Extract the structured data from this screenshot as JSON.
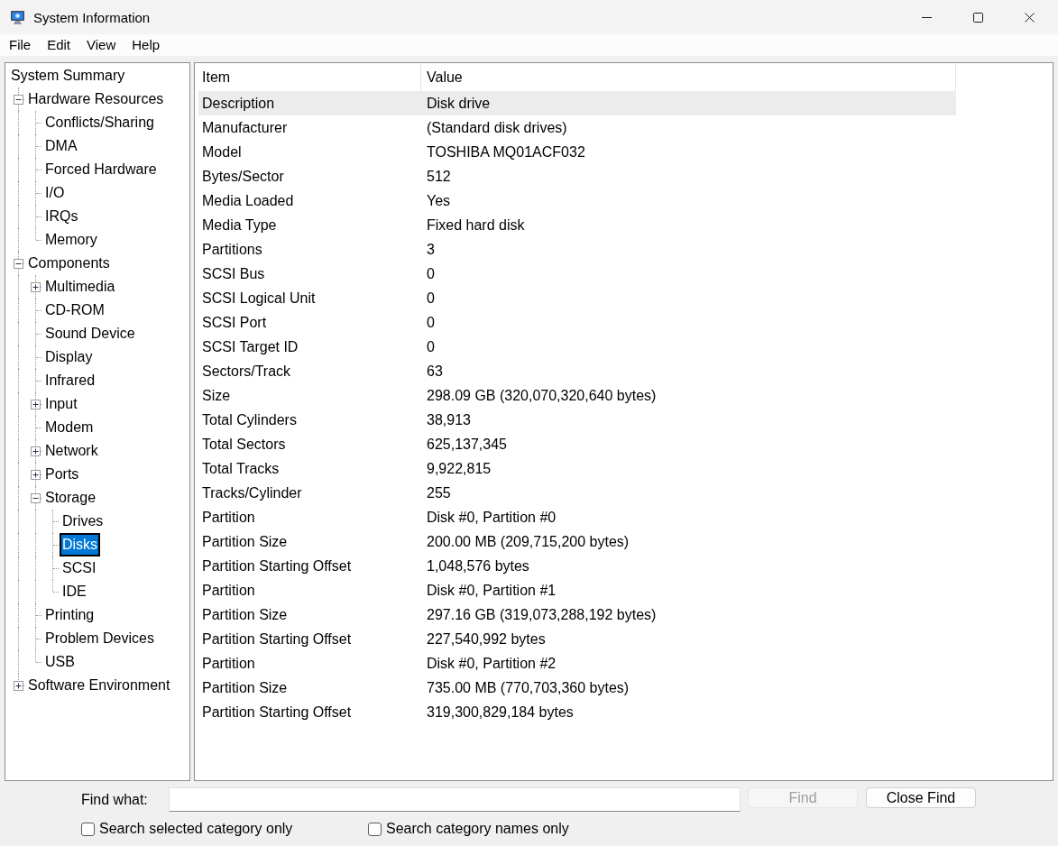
{
  "window": {
    "title": "System Information"
  },
  "menu": [
    "File",
    "Edit",
    "View",
    "Help"
  ],
  "tree": [
    {
      "label": "System Summary",
      "selected": false,
      "children": [
        {
          "label": "Hardware Resources",
          "expanded": true,
          "selected": false,
          "children": [
            {
              "label": "Conflicts/Sharing",
              "selected": false
            },
            {
              "label": "DMA",
              "selected": false
            },
            {
              "label": "Forced Hardware",
              "selected": false
            },
            {
              "label": "I/O",
              "selected": false
            },
            {
              "label": "IRQs",
              "selected": false
            },
            {
              "label": "Memory",
              "selected": false
            }
          ]
        },
        {
          "label": "Components",
          "expanded": true,
          "selected": false,
          "children": [
            {
              "label": "Multimedia",
              "expanded": false,
              "selected": false
            },
            {
              "label": "CD-ROM",
              "selected": false
            },
            {
              "label": "Sound Device",
              "selected": false
            },
            {
              "label": "Display",
              "selected": false
            },
            {
              "label": "Infrared",
              "selected": false
            },
            {
              "label": "Input",
              "expanded": false,
              "selected": false
            },
            {
              "label": "Modem",
              "selected": false
            },
            {
              "label": "Network",
              "expanded": false,
              "selected": false
            },
            {
              "label": "Ports",
              "expanded": false,
              "selected": false
            },
            {
              "label": "Storage",
              "expanded": true,
              "selected": false,
              "children": [
                {
                  "label": "Drives",
                  "selected": false
                },
                {
                  "label": "Disks",
                  "selected": true
                },
                {
                  "label": "SCSI",
                  "selected": false
                },
                {
                  "label": "IDE",
                  "selected": false
                }
              ]
            },
            {
              "label": "Printing",
              "selected": false
            },
            {
              "label": "Problem Devices",
              "selected": false
            },
            {
              "label": "USB",
              "selected": false
            }
          ]
        },
        {
          "label": "Software Environment",
          "expanded": false,
          "selected": false
        }
      ]
    }
  ],
  "table": {
    "columns": [
      "Item",
      "Value"
    ],
    "rows": [
      {
        "item": "Description",
        "value": "Disk drive",
        "selected": true
      },
      {
        "item": "Manufacturer",
        "value": "(Standard disk drives)",
        "selected": false
      },
      {
        "item": "Model",
        "value": "TOSHIBA MQ01ACF032",
        "selected": false
      },
      {
        "item": "Bytes/Sector",
        "value": "512",
        "selected": false
      },
      {
        "item": "Media Loaded",
        "value": "Yes",
        "selected": false
      },
      {
        "item": "Media Type",
        "value": "Fixed hard disk",
        "selected": false
      },
      {
        "item": "Partitions",
        "value": "3",
        "selected": false
      },
      {
        "item": "SCSI Bus",
        "value": "0",
        "selected": false
      },
      {
        "item": "SCSI Logical Unit",
        "value": "0",
        "selected": false
      },
      {
        "item": "SCSI Port",
        "value": "0",
        "selected": false
      },
      {
        "item": "SCSI Target ID",
        "value": "0",
        "selected": false
      },
      {
        "item": "Sectors/Track",
        "value": "63",
        "selected": false
      },
      {
        "item": "Size",
        "value": "298.09 GB (320,070,320,640 bytes)",
        "selected": false
      },
      {
        "item": "Total Cylinders",
        "value": "38,913",
        "selected": false
      },
      {
        "item": "Total Sectors",
        "value": "625,137,345",
        "selected": false
      },
      {
        "item": "Total Tracks",
        "value": "9,922,815",
        "selected": false
      },
      {
        "item": "Tracks/Cylinder",
        "value": "255",
        "selected": false
      },
      {
        "item": "Partition",
        "value": "Disk #0, Partition #0",
        "selected": false
      },
      {
        "item": "Partition Size",
        "value": "200.00 MB (209,715,200 bytes)",
        "selected": false
      },
      {
        "item": "Partition Starting Offset",
        "value": "1,048,576 bytes",
        "selected": false
      },
      {
        "item": "Partition",
        "value": "Disk #0, Partition #1",
        "selected": false
      },
      {
        "item": "Partition Size",
        "value": "297.16 GB (319,073,288,192 bytes)",
        "selected": false
      },
      {
        "item": "Partition Starting Offset",
        "value": "227,540,992 bytes",
        "selected": false
      },
      {
        "item": "Partition",
        "value": "Disk #0, Partition #2",
        "selected": false
      },
      {
        "item": "Partition Size",
        "value": "735.00 MB (770,703,360 bytes)",
        "selected": false
      },
      {
        "item": "Partition Starting Offset",
        "value": "319,300,829,184 bytes",
        "selected": false
      }
    ]
  },
  "find_bar": {
    "label": "Find what:",
    "buttons": [
      {
        "label": "Find",
        "disabled": true
      },
      {
        "label": "Close Find",
        "disabled": false
      }
    ],
    "checkboxes": [
      {
        "label": "Search selected category only",
        "checked": false
      },
      {
        "label": "Search category names only",
        "checked": false
      }
    ]
  }
}
